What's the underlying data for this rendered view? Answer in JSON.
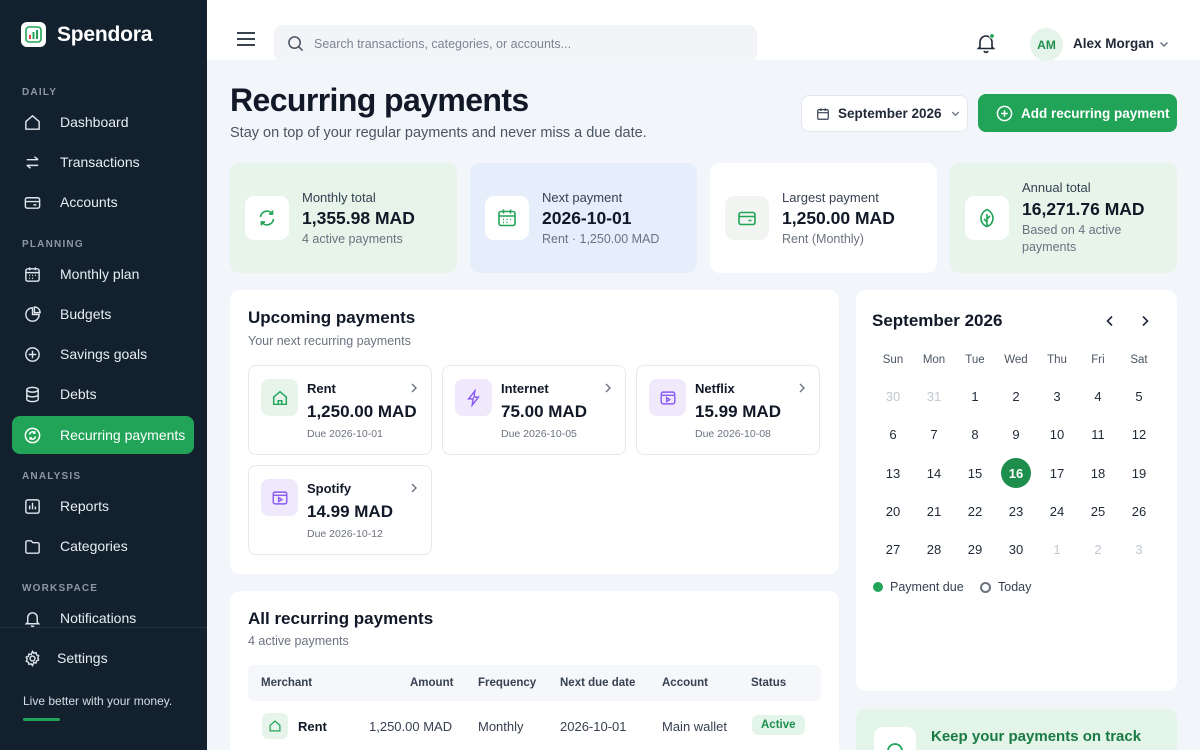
{
  "app": {
    "name": "Spendora"
  },
  "sidebar": {
    "sections": {
      "daily": "DAILY",
      "planning": "PLANNING",
      "analysis": "ANALYSIS",
      "workspace": "WORKSPACE"
    },
    "items": [
      {
        "label": "Dashboard",
        "icon": "home-icon"
      },
      {
        "label": "Transactions",
        "icon": "transfer-icon"
      },
      {
        "label": "Accounts",
        "icon": "wallet-icon"
      },
      {
        "label": "Monthly plan",
        "icon": "calendar-icon"
      },
      {
        "label": "Budgets",
        "icon": "pie-chart-icon"
      },
      {
        "label": "Savings goals",
        "icon": "target-icon"
      },
      {
        "label": "Debts",
        "icon": "database-icon"
      },
      {
        "label": "Recurring payments",
        "icon": "recurring-icon"
      },
      {
        "label": "Reports",
        "icon": "bar-chart-icon"
      },
      {
        "label": "Categories",
        "icon": "folder-icon"
      },
      {
        "label": "Notifications",
        "icon": "bell-icon"
      }
    ],
    "settings": "Settings",
    "tagline": "Live better with your money."
  },
  "topbar": {
    "search_placeholder": "Search transactions, categories, or accounts...",
    "user_initials": "AM",
    "user_name": "Alex Morgan"
  },
  "header": {
    "title": "Recurring payments",
    "subtitle": "Stay on top of your regular payments and never miss a due date.",
    "month": "September 2026",
    "add_button": "Add recurring payment"
  },
  "stats": [
    {
      "label": "Monthly total",
      "value": "1,355.98 MAD",
      "sub": "4 active payments"
    },
    {
      "label": "Next payment",
      "value": "2026-10-01",
      "sub": "Rent · 1,250.00 MAD"
    },
    {
      "label": "Largest payment",
      "value": "1,250.00 MAD",
      "sub": "Rent (Monthly)"
    },
    {
      "label": "Annual total",
      "value": "16,271.76 MAD",
      "sub": "Based on 4 active payments"
    }
  ],
  "upcoming": {
    "title": "Upcoming payments",
    "subtitle": "Your next recurring payments",
    "items": [
      {
        "name": "Rent",
        "amount": "1,250.00 MAD",
        "due": "Due 2026-10-01"
      },
      {
        "name": "Internet",
        "amount": "75.00 MAD",
        "due": "Due 2026-10-05"
      },
      {
        "name": "Netflix",
        "amount": "15.99 MAD",
        "due": "Due 2026-10-08"
      },
      {
        "name": "Spotify",
        "amount": "14.99 MAD",
        "due": "Due 2026-10-12"
      }
    ]
  },
  "all_payments": {
    "title": "All recurring payments",
    "subtitle": "4 active payments",
    "columns": [
      "Merchant",
      "Amount",
      "Frequency",
      "Next due date",
      "Account",
      "Status"
    ],
    "rows": [
      {
        "merchant": "Rent",
        "amount": "1,250.00 MAD",
        "frequency": "Monthly",
        "next_due": "2026-10-01",
        "account": "Main wallet",
        "status": "Active"
      }
    ]
  },
  "calendar": {
    "title": "September 2026",
    "weekdays": [
      "Sun",
      "Mon",
      "Tue",
      "Wed",
      "Thu",
      "Fri",
      "Sat"
    ],
    "weeks": [
      [
        "30",
        "31",
        "1",
        "2",
        "3",
        "4",
        "5"
      ],
      [
        "6",
        "7",
        "8",
        "9",
        "10",
        "11",
        "12"
      ],
      [
        "13",
        "14",
        "15",
        "16",
        "17",
        "18",
        "19"
      ],
      [
        "20",
        "21",
        "22",
        "23",
        "24",
        "25",
        "26"
      ],
      [
        "27",
        "28",
        "29",
        "30",
        "1",
        "2",
        "3"
      ]
    ],
    "selected_day": "16",
    "legend_due": "Payment due",
    "legend_today": "Today"
  },
  "tip": {
    "title": "Keep your payments on track"
  },
  "colors": {
    "accent": "#22a458",
    "sidebar_bg": "#13212f",
    "page_bg": "#f2f5fa"
  }
}
